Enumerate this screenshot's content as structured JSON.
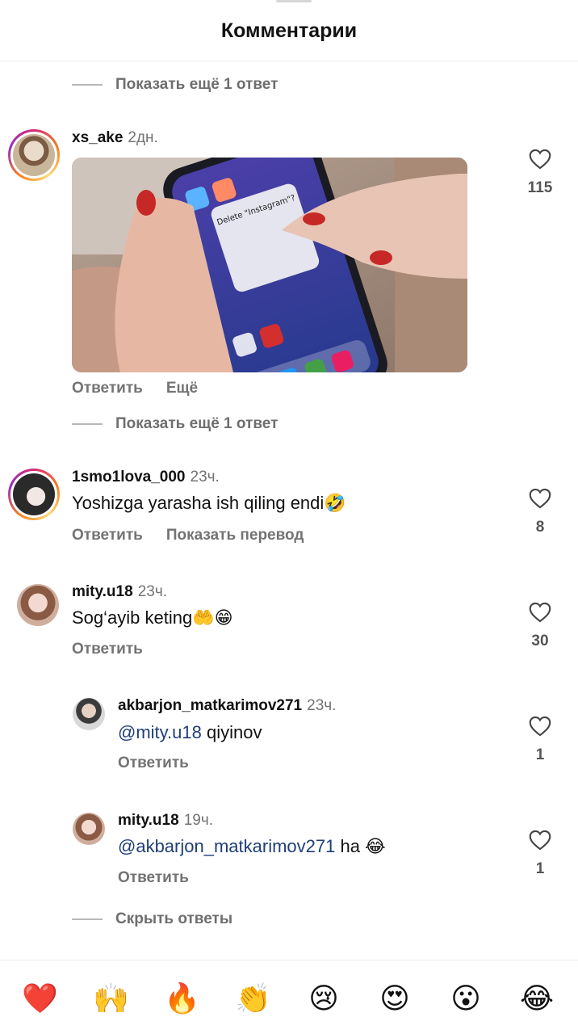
{
  "header": {
    "title": "Комментарии"
  },
  "more_replies_label": "Показать ещё 1 ответ",
  "hide_replies_label": "Скрыть ответы",
  "reply_label": "Ответить",
  "more_label": "Ещё",
  "translate_label": "Показать перевод",
  "comments": [
    {
      "username": "xs_ake",
      "time": "2дн.",
      "likes": "115",
      "media_text": "Delete \"Instagram\"?"
    },
    {
      "username": "1smo1lova_000",
      "time": "23ч.",
      "text": "Yoshizga yarasha ish qiling endi🤣",
      "likes": "8"
    },
    {
      "username": "mity.u18",
      "time": "23ч.",
      "text": "Sog‘ayib keting🤲😁",
      "likes": "30"
    }
  ],
  "replies": [
    {
      "username": "akbarjon_matkarimov271",
      "time": "23ч.",
      "mention": "@mity.u18",
      "text": " qiyinov",
      "likes": "1"
    },
    {
      "username": "mity.u18",
      "time": "19ч.",
      "mention": "@akbarjon_matkarimov271",
      "text": " ha 😂",
      "likes": "1"
    }
  ],
  "reactions": [
    "❤️",
    "🙌",
    "🔥",
    "👏",
    "😢",
    "😍",
    "😮",
    "😂"
  ],
  "colors": {
    "mention": "#1f3e78",
    "secondary_text": "#737373",
    "story_ring": "#d62976"
  }
}
